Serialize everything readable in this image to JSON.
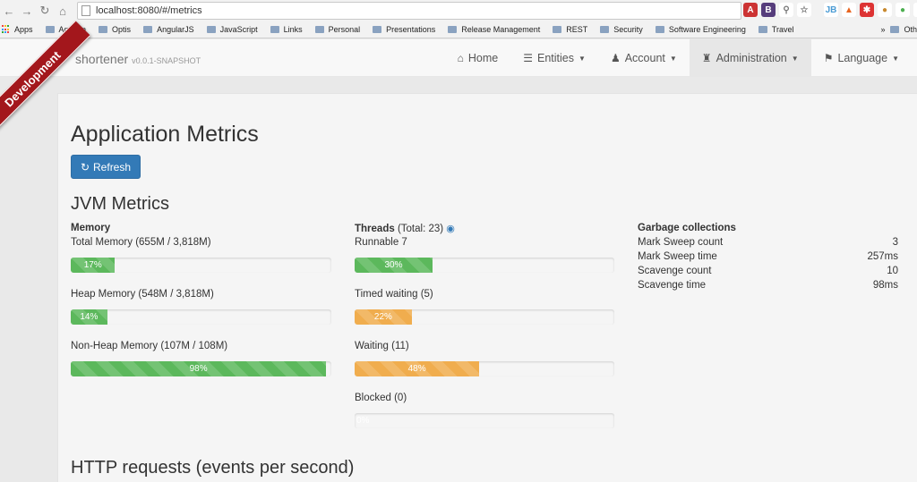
{
  "browser": {
    "url": "localhost:8080/#/metrics",
    "bookmarks": [
      "Apps",
      "Aquafin",
      "Optis",
      "AngularJS",
      "JavaScript",
      "Links",
      "Personal",
      "Presentations",
      "Release Management",
      "REST",
      "Security",
      "Software Engineering",
      "Travel"
    ],
    "overflow": "»",
    "other": "Oth"
  },
  "navbar": {
    "brand": "shortener",
    "version": "v0.0.1-SNAPSHOT",
    "items": [
      {
        "label": "Home",
        "icon": "home-icon"
      },
      {
        "label": "Entities",
        "icon": "list-icon"
      },
      {
        "label": "Account",
        "icon": "user-icon"
      },
      {
        "label": "Administration",
        "icon": "tower-icon"
      },
      {
        "label": "Language",
        "icon": "flag-icon"
      }
    ],
    "active": "Administration"
  },
  "ribbon": "Development",
  "page": {
    "title": "Application Metrics",
    "refresh_label": "Refresh",
    "jvm_title": "JVM Metrics",
    "http_title": "HTTP requests (events per second)"
  },
  "memory": {
    "heading": "Memory",
    "items": [
      {
        "label": "Total Memory (655M / 3,818M)",
        "percent": 17,
        "percent_label": "17%"
      },
      {
        "label": "Heap Memory (548M / 3,818M)",
        "percent": 14,
        "percent_label": "14%"
      },
      {
        "label": "Non-Heap Memory (107M / 108M)",
        "percent": 98,
        "percent_label": "98%"
      }
    ]
  },
  "threads": {
    "heading": "Threads",
    "total": "(Total: 23)",
    "items": [
      {
        "label": "Runnable 7",
        "percent": 30,
        "percent_label": "30%",
        "color": "#5cb85c"
      },
      {
        "label": "Timed waiting (5)",
        "percent": 22,
        "percent_label": "22%",
        "color": "#f0ad4e"
      },
      {
        "label": "Waiting (11)",
        "percent": 48,
        "percent_label": "48%",
        "color": "#f0ad4e"
      },
      {
        "label": "Blocked (0)",
        "percent": 0,
        "percent_label": "0%",
        "color": "#d9534f"
      }
    ]
  },
  "gc": {
    "heading": "Garbage collections",
    "rows": [
      {
        "label": "Mark Sweep count",
        "value": "3"
      },
      {
        "label": "Mark Sweep time",
        "value": "257ms"
      },
      {
        "label": "Scavenge count",
        "value": "10"
      },
      {
        "label": "Scavenge time",
        "value": "98ms"
      }
    ]
  }
}
